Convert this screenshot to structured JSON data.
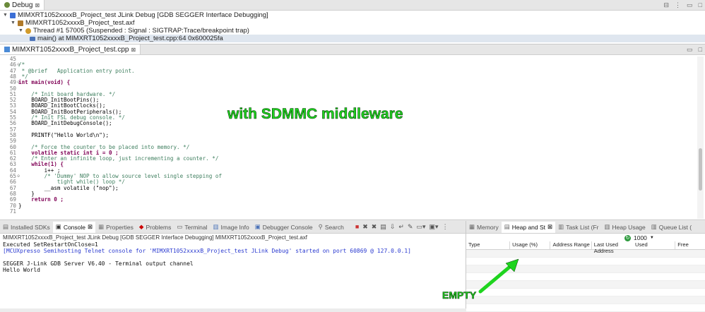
{
  "debug": {
    "tab_label": "Debug",
    "tree": [
      {
        "label": "MIMXRT1052xxxxB_Project_test JLink Debug [GDB SEGGER Interface Debugging]",
        "icon": "launch-config-icon"
      },
      {
        "label": "MIMXRT1052xxxxB_Project_test.axf",
        "icon": "process-icon"
      },
      {
        "label": "Thread #1 57005 (Suspended : Signal : SIGTRAP:Trace/breakpoint trap)",
        "icon": "thread-icon"
      },
      {
        "label": "main() at MIMXRT1052xxxxB_Project_test.cpp:64 0x600025fa",
        "icon": "stack-frame-icon"
      }
    ]
  },
  "editor": {
    "tab_label": "MIMXRT1052xxxxB_Project_test.cpp",
    "line_numbers": [
      "45",
      "46",
      "47",
      "48",
      "49",
      "50",
      "51",
      "52",
      "53",
      "54",
      "55",
      "56",
      "57",
      "58",
      "59",
      "60",
      "61",
      "62",
      "63",
      "64",
      "65",
      "66",
      "67",
      "68",
      "69",
      "70",
      "71"
    ],
    "lines": [
      "",
      "/*",
      " * @brief   Application entry point.",
      " */",
      "int main(void) {",
      "",
      "    /* Init board hardware. */",
      "    BOARD_InitBootPins();",
      "    BOARD_InitBootClocks();",
      "    BOARD_InitBootPeripherals();",
      "    /* Init FSL debug console. */",
      "    BOARD_InitDebugConsole();",
      "",
      "    PRINTF(\"Hello World\\n\");",
      "",
      "    /* Force the counter to be placed into memory. */",
      "    volatile static int i = 0 ;",
      "    /* Enter an infinite loop, just incrementing a counter. */",
      "    while(1) {",
      "        i++ ;",
      "        /* 'Dummy' NOP to allow source level single stepping of",
      "            tight while() loop */",
      "        __asm volatile (\"nop\");",
      "    }",
      "    return 0 ;",
      "}",
      ""
    ],
    "overlay_text": "with SDMMC middleware"
  },
  "console": {
    "tabs": [
      "Installed SDKs",
      "Console",
      "Properties",
      "Problems",
      "Terminal",
      "Image Info",
      "Debugger Console",
      "Search"
    ],
    "active_tab": "Console",
    "header": "MIMXRT1052xxxxB_Project_test JLink Debug [GDB SEGGER Interface Debugging] MIMXRT1052xxxxB_Project_test.axf",
    "output": [
      "Executed SetRestartOnClose=1",
      "[MCUXpresso Semihosting Telnet console for 'MIMXRT1052xxxxB_Project_test JLink Debug' started on port 60869 @ 127.0.0.1]",
      "",
      "SEGGER J-Link GDB Server V6.40 - Terminal output channel",
      "Hello World"
    ]
  },
  "heap": {
    "tabs": [
      "Memory",
      "Heap and St",
      "Task List (Fr",
      "Heap Usage",
      "Queue List ("
    ],
    "active_tab": "Heap and St",
    "refresh_value": "1000",
    "columns": [
      "Type",
      "Usage (%)",
      "Address Range",
      "Last Used Address",
      "Used",
      "Free"
    ],
    "annotation": "EMPTY"
  },
  "colors": {
    "annotation_green": "#1fd41f",
    "comment_green": "#3f7f5f",
    "keyword_purple": "#7f0055",
    "string_blue": "#2a00ff",
    "highlight_row": "#dfe6ef"
  }
}
